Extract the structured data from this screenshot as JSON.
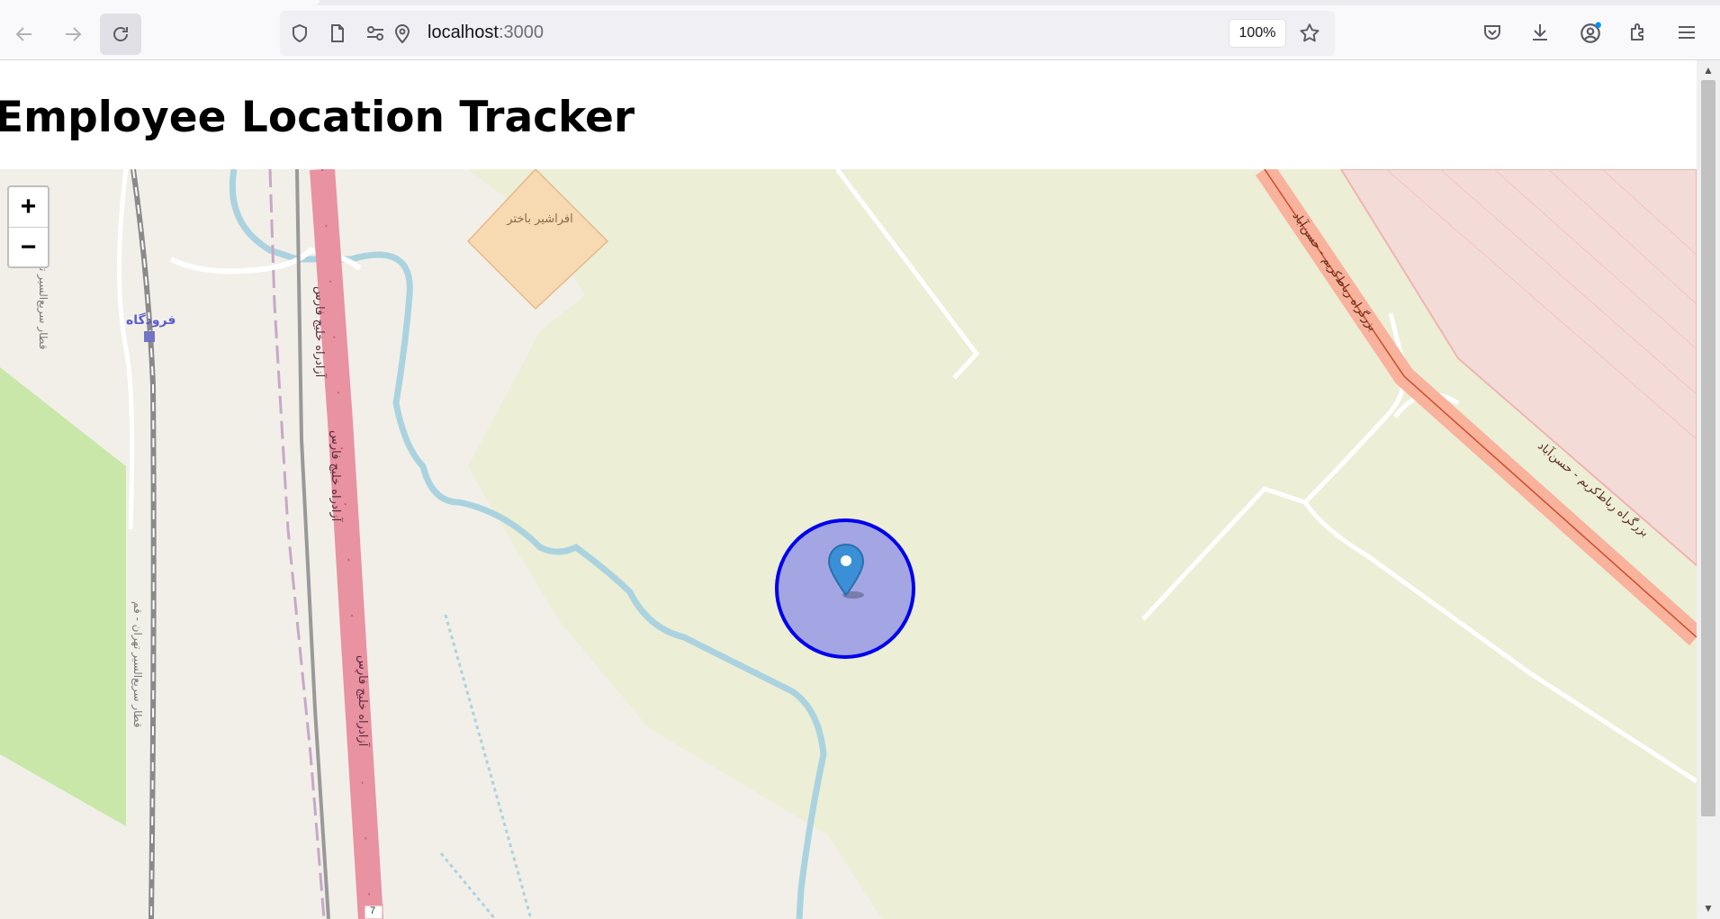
{
  "browser": {
    "url_host": "localhost",
    "url_port": ":3000",
    "zoom": "100%"
  },
  "page": {
    "title": "Employee Location Tracker"
  },
  "map": {
    "zoom_in_label": "+",
    "zoom_out_label": "−",
    "labels": {
      "poi": "افراشیر باختر",
      "airport": "فرودگاه",
      "rail_top": "قطار سریع‌السیر تهران - قم",
      "rail_bottom": "قطار سریع‌السیر تهران - قم",
      "freeway_a": "آزادراه خلیج فارس",
      "freeway_b": "آزادراه خلیج فارس",
      "freeway_c": "آزادراه خلیج فارس",
      "highway_a": "بزرگراه رباط‌کریم - حسن‌آباد",
      "highway_b": "بزرگراه رباط‌کریم - حسن‌آباد",
      "route_shield": "7"
    },
    "marker": {
      "icon": "map-pin-icon",
      "circle_color": "#0000ee",
      "circle_fill": "#a3a6e2"
    }
  }
}
